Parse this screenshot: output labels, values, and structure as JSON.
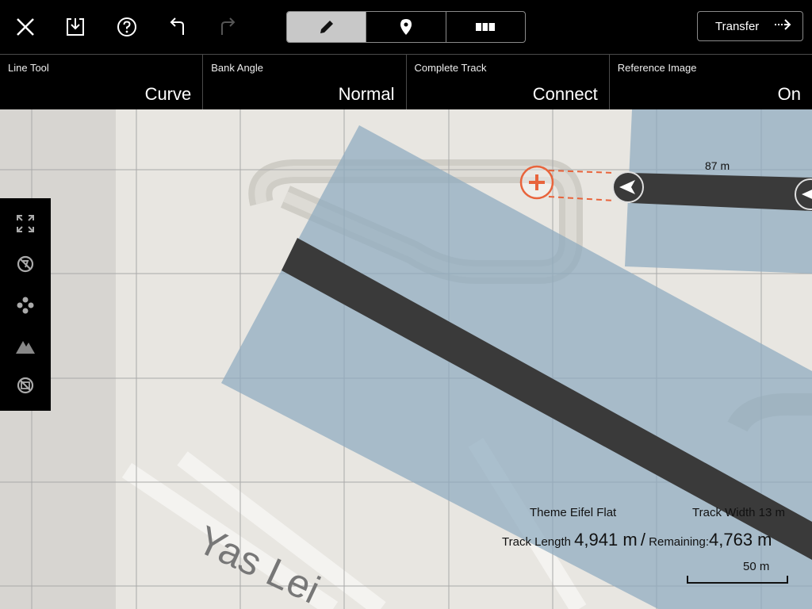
{
  "toolbar": {
    "close_icon": "close-icon",
    "save_icon": "save-download-icon",
    "help_icon": "help-icon",
    "undo_icon": "undo-icon",
    "redo_icon": "redo-icon",
    "modes": [
      "pencil-icon",
      "location-pin-icon",
      "split-view-icon"
    ],
    "active_mode": 0,
    "transfer_label": "Transfer"
  },
  "settings": [
    {
      "label": "Line Tool",
      "value": "Curve"
    },
    {
      "label": "Bank Angle",
      "value": "Normal"
    },
    {
      "label": "Complete Track",
      "value": "Connect"
    },
    {
      "label": "Reference Image",
      "value": "On"
    }
  ],
  "sidebar": {
    "icons": [
      "expand-icon",
      "no-symbol-icon",
      "dpad-icon",
      "mountain-icon",
      "no-image-icon"
    ]
  },
  "map": {
    "street_label": "Yas Lei",
    "segment_length": "87 m",
    "colors": {
      "track": "#3a3a3a",
      "overlay": "#8eaabf",
      "accent": "#e8643c"
    }
  },
  "stats": {
    "theme_label": "Theme",
    "theme_value": "Eifel Flat",
    "width_label": "Track Width",
    "width_value": "13 m",
    "length_label": "Track Length",
    "length_value": "4,941 m",
    "separator": "/",
    "remaining_label": "Remaining:",
    "remaining_value": "4,763 m",
    "scale_label": "50 m"
  }
}
